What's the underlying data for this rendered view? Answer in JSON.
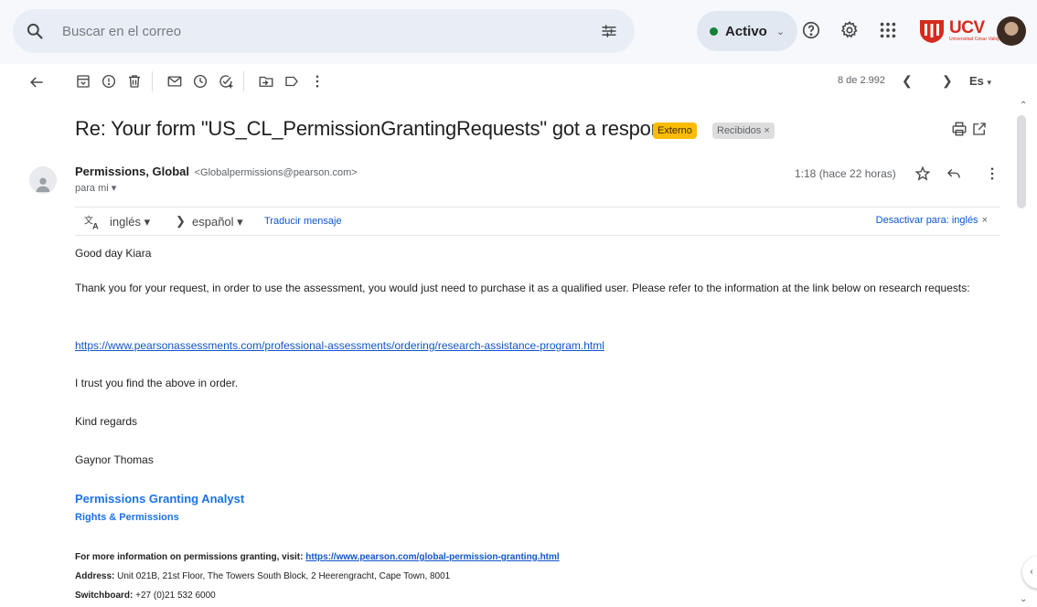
{
  "search": {
    "placeholder": "Buscar en el correo"
  },
  "status": {
    "label": "Activo",
    "color": "#188038"
  },
  "brand": {
    "logo_text": "UCV",
    "logo_subtext": "Universidad César Vallejo"
  },
  "toolbar": {
    "counter": "8 de 2.992",
    "language": "Es"
  },
  "message": {
    "subject": "Re: Your form \"US_CL_PermissionGrantingRequests\" got a response",
    "labels": {
      "external": "Externo",
      "inbox": "Recibidos"
    },
    "sender_name": "Permissions, Global",
    "sender_email": "<Globalpermissions@pearson.com>",
    "recipient": "para mi",
    "time": "1:18 (hace 22 horas)"
  },
  "translate": {
    "from": "inglés",
    "to": "español",
    "action": "Traducir mensaje",
    "disable": "Desactivar para: inglés"
  },
  "body": {
    "greeting": "Good day Kiara",
    "para1": "Thank you for your request, in order to use the assessment, you would just need to purchase it as a qualified user. Please refer to the information at the link below on research requests:",
    "link": "https://www.pearsonassessments.com/professional-assessments/ordering/research-assistance-program.html",
    "para2": "I trust you find the above in order.",
    "closing": "Kind regards",
    "signer": "Gaynor Thomas",
    "sig_title": "Permissions Granting Analyst",
    "sig_dept": "Rights & Permissions",
    "more_info_label": "For more information on permissions granting, visit:",
    "more_info_link": "https://www.pearson.com/global-permission-granting.html",
    "address_label": "Address:",
    "address": "Unit 021B, 21st Floor, The Towers South Block, 2 Heerengracht, Cape Town, 8001",
    "switchboard_label": "Switchboard:",
    "switchboard": "+27 (0)21 532 6000"
  }
}
